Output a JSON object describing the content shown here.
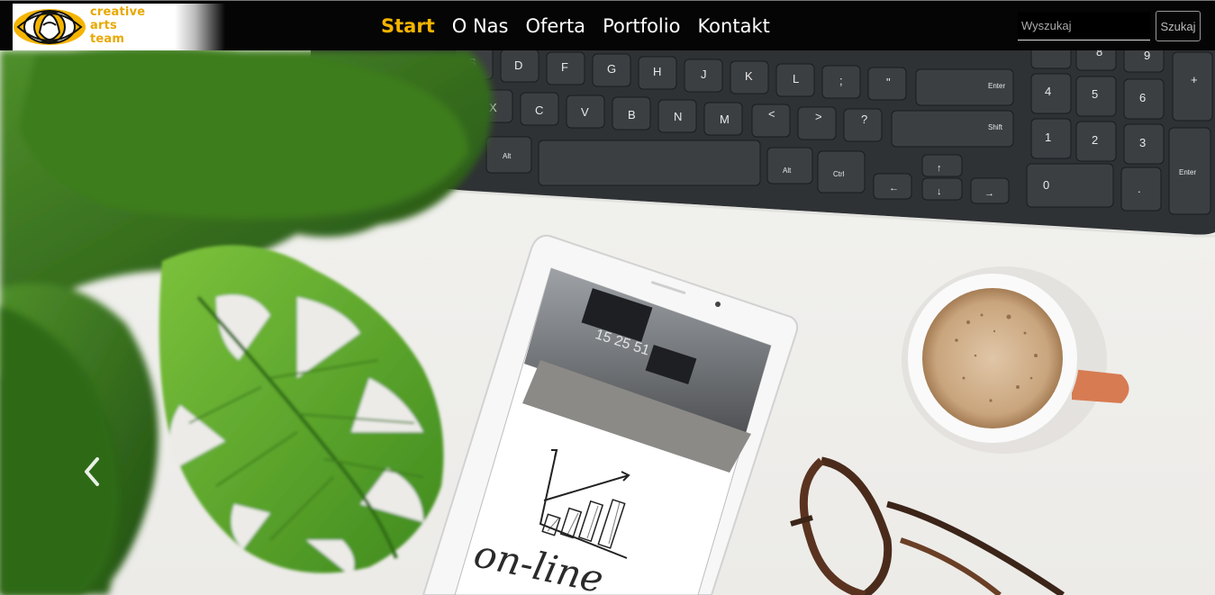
{
  "brand": {
    "logo_lines": [
      "creative",
      "arts",
      "team"
    ],
    "accent": "#f5b400"
  },
  "nav": {
    "items": [
      {
        "label": "Start",
        "active": true
      },
      {
        "label": "O Nas",
        "active": false
      },
      {
        "label": "Oferta",
        "active": false
      },
      {
        "label": "Portfolio",
        "active": false
      },
      {
        "label": "Kontakt",
        "active": false
      }
    ]
  },
  "search": {
    "placeholder": "Wyszukaj",
    "button_label": "Szukaj"
  },
  "carousel": {
    "prev_label": "Previous",
    "prev_icon": "chevron-left-icon"
  },
  "hero": {
    "tablet_clock": "15 25 51",
    "tablet_caption": "on-line"
  }
}
